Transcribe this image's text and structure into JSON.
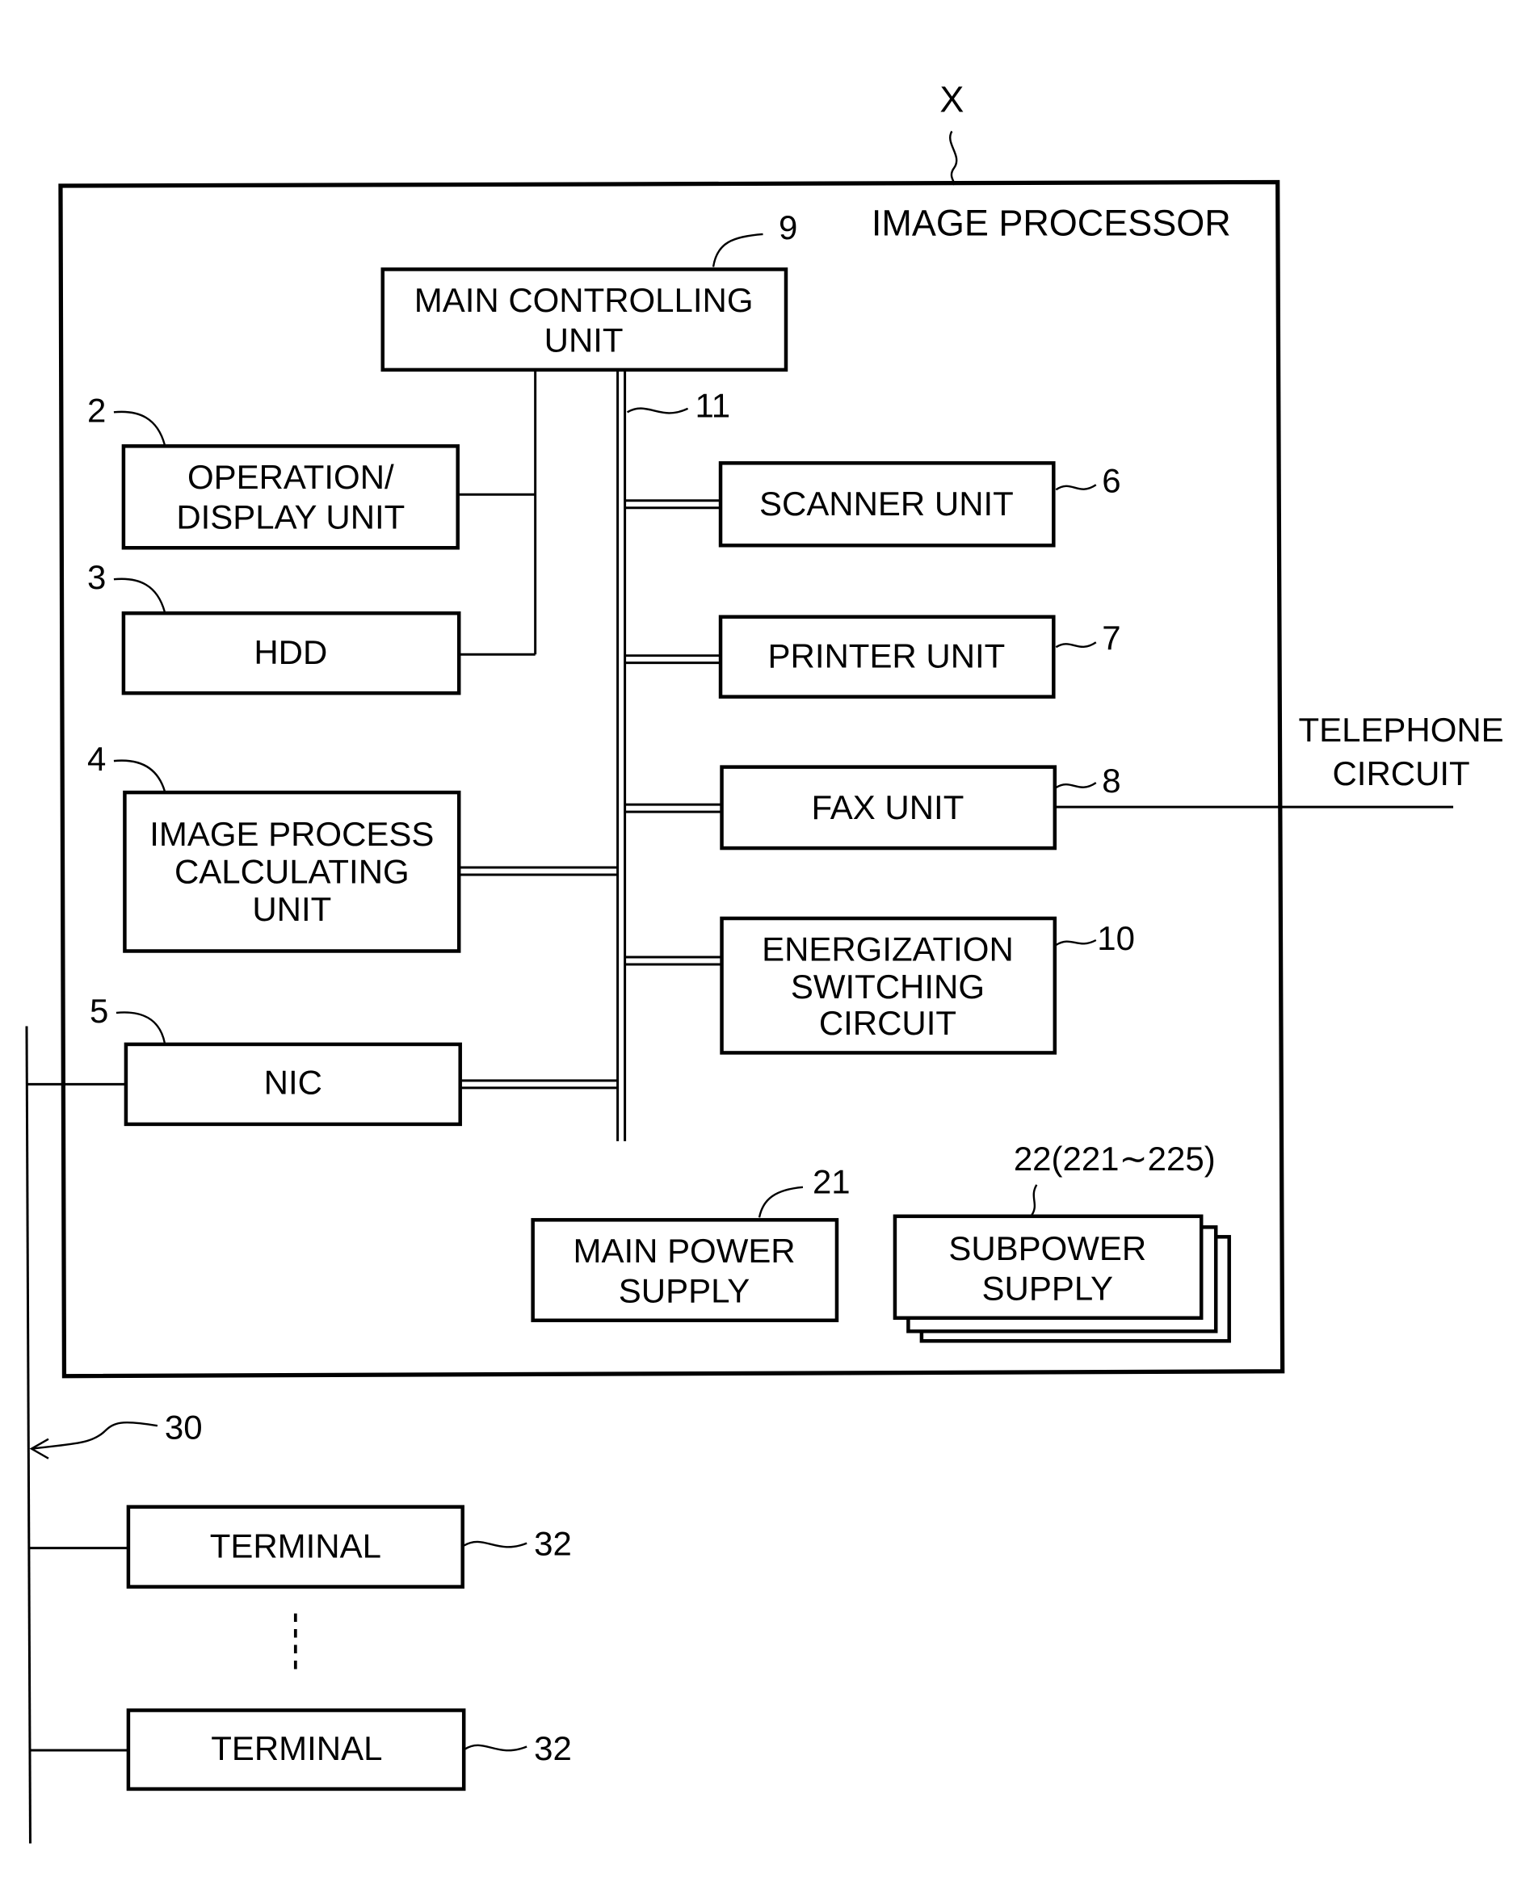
{
  "figure": {
    "device_ref": "X",
    "device_title": "IMAGE PROCESSOR"
  },
  "blocks": {
    "main_controlling_unit": {
      "lines": [
        "MAIN CONTROLLING",
        "UNIT"
      ],
      "ref": "9"
    },
    "operation_display_unit": {
      "lines": [
        "OPERATION/",
        "DISPLAY UNIT"
      ],
      "ref": "2"
    },
    "hdd": {
      "lines": [
        "HDD"
      ],
      "ref": "3"
    },
    "image_process_calculating_unit": {
      "lines": [
        "IMAGE PROCESS",
        "CALCULATING",
        "UNIT"
      ],
      "ref": "4"
    },
    "nic": {
      "lines": [
        "NIC"
      ],
      "ref": "5"
    },
    "scanner_unit": {
      "lines": [
        "SCANNER UNIT"
      ],
      "ref": "6"
    },
    "printer_unit": {
      "lines": [
        "PRINTER UNIT"
      ],
      "ref": "7"
    },
    "fax_unit": {
      "lines": [
        "FAX UNIT"
      ],
      "ref": "8"
    },
    "energization_switching_circuit": {
      "lines": [
        "ENERGIZATION",
        "SWITCHING",
        "CIRCUIT"
      ],
      "ref": "10"
    },
    "main_power_supply": {
      "lines": [
        "MAIN POWER",
        "SUPPLY"
      ],
      "ref": "21"
    },
    "subpower_supply": {
      "lines": [
        "SUBPOWER",
        "SUPPLY"
      ],
      "ref": "22(221∼225)"
    }
  },
  "bus_ref": "11",
  "telephone_circuit": {
    "lines": [
      "TELEPHONE",
      "CIRCUIT"
    ]
  },
  "network_ref": "30",
  "terminals": [
    {
      "label": "TERMINAL",
      "ref": "32"
    },
    {
      "label": "TERMINAL",
      "ref": "32"
    }
  ]
}
